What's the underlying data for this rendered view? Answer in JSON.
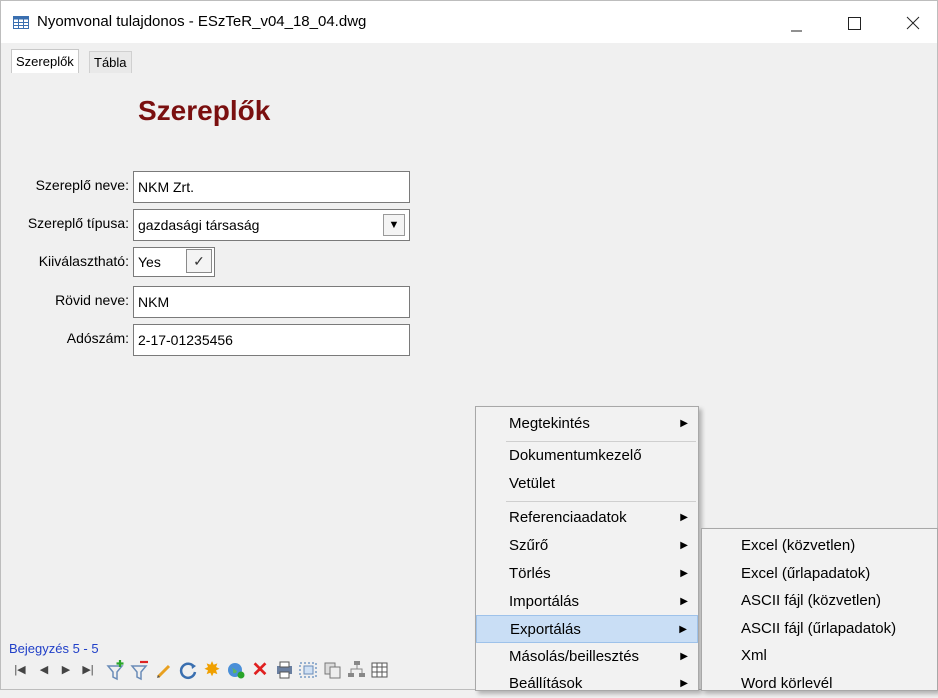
{
  "window": {
    "title": "Nyomvonal tulajdonos - ESzTeR_v04_18_04.dwg",
    "minimize": "—",
    "maximize": "☐",
    "close": "✕"
  },
  "tabs": [
    {
      "label": "Szereplők"
    },
    {
      "label": "Tábla"
    }
  ],
  "form": {
    "heading": "Szereplők",
    "name_label": "Szereplő neve:",
    "name_value": "NKM Zrt.",
    "type_label": "Szereplő típusa:",
    "type_value": "gazdasági társaság",
    "selectable_label": "Kiiválasztható:",
    "selectable_value": "Yes",
    "short_label": "Rövid neve:",
    "short_value": "NKM",
    "tax_label": "Adószám:",
    "tax_value": "2-17-01235456"
  },
  "status": {
    "record": "Bejegyzés 5 - 5"
  },
  "toolbar": {
    "icons": [
      "first-record-icon",
      "prev-record-icon",
      "next-record-icon",
      "last-record-icon",
      "add-filter-icon",
      "remove-filter-icon",
      "edit-icon",
      "refresh-icon",
      "new-record-icon",
      "globe-icon",
      "delete-icon",
      "print-icon",
      "select-icon",
      "copy-icon",
      "tree-icon",
      "table-icon"
    ]
  },
  "context_menu": {
    "items": [
      {
        "label": "Megtekintés",
        "arrow": "▶"
      },
      {
        "label": "Dokumentumkezelő"
      },
      {
        "label": "Vetület"
      },
      {
        "label": "Referenciaadatok",
        "arrow": "▶"
      },
      {
        "label": "Szűrő",
        "arrow": "▶"
      },
      {
        "label": "Törlés",
        "arrow": "▶"
      },
      {
        "label": "Importálás",
        "arrow": "▶"
      },
      {
        "label": "Exportálás",
        "arrow": "▶",
        "selected": true
      },
      {
        "label": "Másolás/beillesztés",
        "arrow": "▶"
      },
      {
        "label": "Beállítások",
        "arrow": "▶"
      }
    ]
  },
  "submenu": {
    "items": [
      {
        "label": "Excel (közvetlen)"
      },
      {
        "label": "Excel (űrlapadatok)"
      },
      {
        "label": "ASCII fájl (közvetlen)"
      },
      {
        "label": "ASCII fájl (űrlapadatok)"
      },
      {
        "label": "Xml"
      },
      {
        "label": "Word körlevél"
      }
    ]
  },
  "colors": {
    "heading": "#7a0f0f",
    "status_text": "#2140c8",
    "menu_highlight": "#c9def5"
  }
}
